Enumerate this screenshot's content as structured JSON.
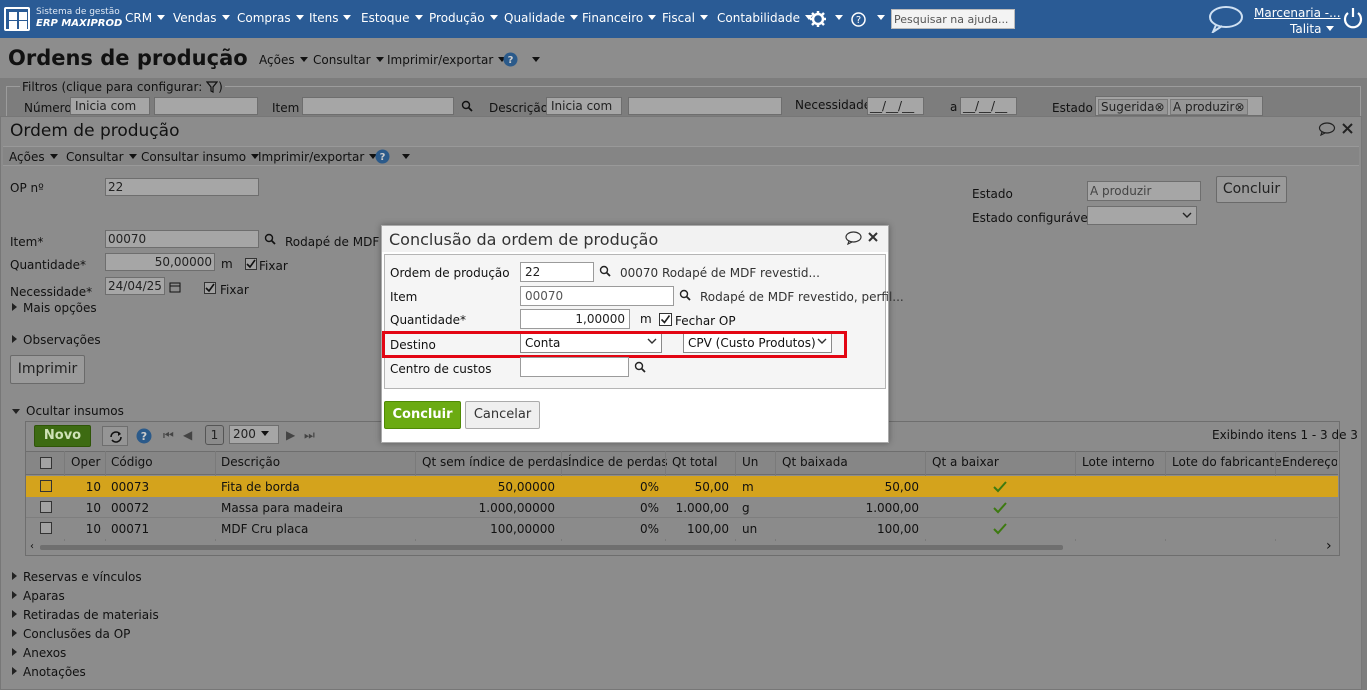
{
  "brand": {
    "line1": "Sistema de gestão",
    "line2": "ERP MAXIPROD"
  },
  "nav": {
    "items": [
      "CRM",
      "Vendas",
      "Compras",
      "Itens",
      "Estoque",
      "Produção",
      "Qualidade",
      "Financeiro",
      "Fiscal",
      "Contabilidade"
    ],
    "search_placeholder": "Pesquisar na ajuda...",
    "company": "Marcenaria -...",
    "user": "Talita"
  },
  "page": {
    "title": "Ordens de produção",
    "toolbar": [
      "Ações",
      "Consultar",
      "Imprimir/exportar"
    ],
    "filters_label": "Filtros (clique para configurar:",
    "filters": {
      "numero": "Número",
      "numero_mode": "Inicia com",
      "item": "Item",
      "descricao": "Descrição",
      "descricao_mode": "Inicia com",
      "necessidade": "Necessidade",
      "date_placeholder": "__/__/__",
      "a": "a",
      "estado": "Estado",
      "estado_tags": [
        "Sugerida",
        "A produzir"
      ]
    }
  },
  "op": {
    "title": "Ordem de produção",
    "toolbar": [
      "Ações",
      "Consultar",
      "Consultar insumo",
      "Imprimir/exportar"
    ],
    "op_no_label": "OP nº",
    "op_no": "22",
    "item_label": "Item*",
    "item_code": "00070",
    "item_desc": "Rodapé de MDF re",
    "qty_label": "Quantidade*",
    "qty": "50,00000",
    "qty_unit": "m",
    "fixar": "Fixar",
    "need_label": "Necessidade*",
    "need_date": "24/04/25",
    "more": "Mais opções",
    "obs": "Observações",
    "print_btn": "Imprimir",
    "estado_label": "Estado",
    "estado_value": "A produzir",
    "estado_conf_label": "Estado configurável",
    "concluir_btn": "Concluir",
    "insumos_label": "Ocultar insumos"
  },
  "grid": {
    "new_btn": "Novo",
    "page": "1",
    "page_size": "200",
    "showing": "Exibindo itens 1 - 3 de 3",
    "headers": [
      "Oper",
      "Código",
      "Descrição",
      "Qt sem índice de perdas",
      "Índice de perdas",
      "Qt total",
      "Un",
      "Qt baixada",
      "Qt a baixar",
      "Lote interno",
      "Lote do fabricante",
      "Endereço e"
    ],
    "rows": [
      {
        "oper": "10",
        "codigo": "00073",
        "descricao": "Fita de borda",
        "qt_sem": "50,00000",
        "indice": "0%",
        "qt_total": "50,00",
        "un": "m",
        "qt_baixada": "50,00"
      },
      {
        "oper": "10",
        "codigo": "00072",
        "descricao": "Massa para madeira",
        "qt_sem": "1.000,00000",
        "indice": "0%",
        "qt_total": "1.000,00",
        "un": "g",
        "qt_baixada": "1.000,00"
      },
      {
        "oper": "10",
        "codigo": "00071",
        "descricao": "MDF Cru placa",
        "qt_sem": "100,00000",
        "indice": "0%",
        "qt_total": "100,00",
        "un": "un",
        "qt_baixada": "100,00"
      }
    ]
  },
  "sections": [
    "Reservas e vínculos",
    "Aparas",
    "Retiradas de materiais",
    "Conclusões da OP",
    "Anexos",
    "Anotações"
  ],
  "modal": {
    "title": "Conclusão da ordem de produção",
    "op_label": "Ordem de produção",
    "op_value": "22",
    "op_desc": "00070 Rodapé de MDF revestid...",
    "item_label": "Item",
    "item_value": "00070",
    "item_desc": "Rodapé de MDF revestido, perfil...",
    "qty_label": "Quantidade*",
    "qty_value": "1,00000",
    "qty_unit": "m",
    "close_op": "Fechar OP",
    "dest_label": "Destino",
    "dest_value": "Conta",
    "account_value": "CPV (Custo Produtos)",
    "cost_center_label": "Centro de custos",
    "cost_center_value": "",
    "concluir": "Concluir",
    "cancelar": "Cancelar"
  },
  "colors": {
    "nav": "#2a5b95",
    "accent_green": "#6bab12",
    "highlight": "#e30613",
    "row_selected": "#d4a31c"
  }
}
